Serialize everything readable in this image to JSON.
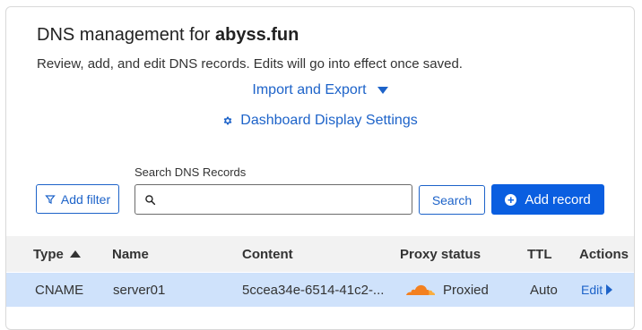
{
  "header": {
    "title_prefix": "DNS management for",
    "domain": "abyss.fun",
    "subtitle": "Review, add, and edit DNS records. Edits will go into effect once saved."
  },
  "links": {
    "import_export": "Import and Export",
    "display_settings": "Dashboard Display Settings"
  },
  "toolbar": {
    "search_label": "Search DNS Records",
    "search_value": "",
    "filter_label": "Add filter",
    "search_button": "Search",
    "add_record": "Add record"
  },
  "table": {
    "columns": [
      "Type",
      "Name",
      "Content",
      "Proxy status",
      "TTL",
      "Actions"
    ],
    "rows": [
      {
        "type": "CNAME",
        "name": "server01",
        "content": "5ccea34e-6514-41c2-...",
        "proxy_status": "Proxied",
        "ttl": "Auto",
        "action": "Edit"
      }
    ]
  },
  "colors": {
    "link": "#1d63c9",
    "primary": "#0a5ee0",
    "row_highlight": "#cfe2fb",
    "cloud": "#f38020"
  }
}
